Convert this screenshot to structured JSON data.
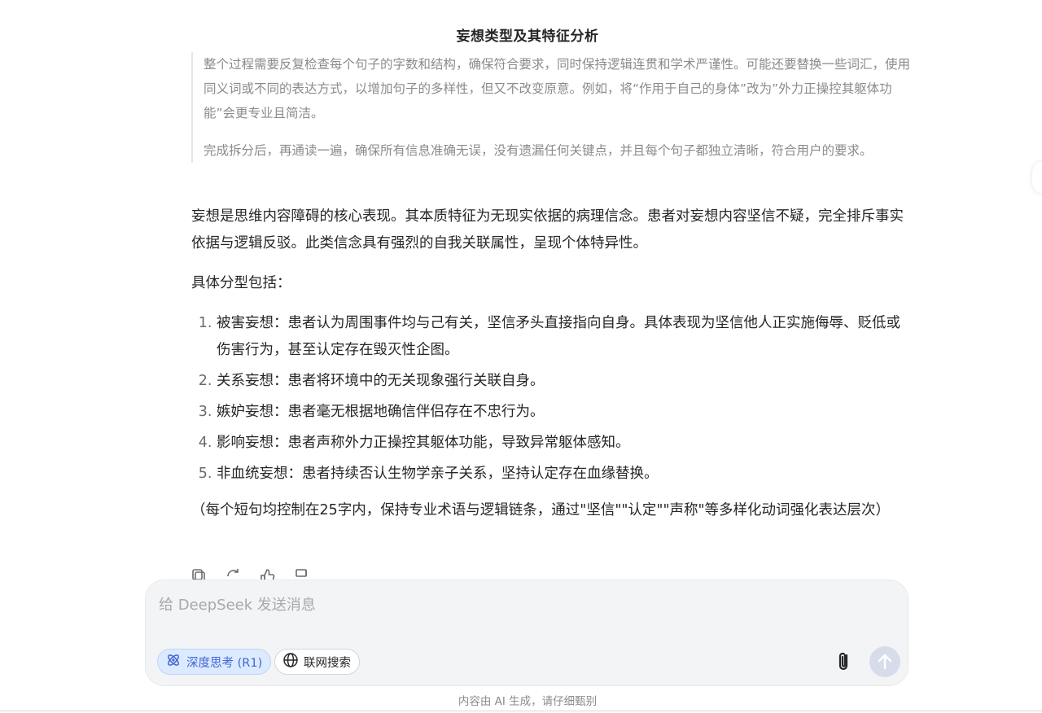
{
  "header": {
    "title": "妄想类型及其特征分析"
  },
  "thinking": {
    "paragraphs": [
      "整个过程需要反复检查每个句子的字数和结构，确保符合要求，同时保持逻辑连贯和学术严谨性。可能还要替换一些词汇，使用同义词或不同的表达方式，以增加句子的多样性，但又不改变原意。例如，将“作用于自己的身体”改为”外力正操控其躯体功能”会更专业且简洁。",
      "完成拆分后，再通读一遍，确保所有信息准确无误，没有遗漏任何关键点，并且每个句子都独立清晰，符合用户的要求。"
    ]
  },
  "answer": {
    "intro": "妄想是思维内容障碍的核心表现。其本质特征为无现实依据的病理信念。患者对妄想内容坚信不疑，完全排斥事实依据与逻辑反驳。此类信念具有强烈的自我关联属性，呈现个体特异性。",
    "list_heading": "具体分型包括：",
    "items": [
      "被害妄想：患者认为周围事件均与己有关，坚信矛头直接指向自身。具体表现为坚信他人正实施侮辱、贬低或伤害行为，甚至认定存在毁灭性企图。",
      "关系妄想：患者将环境中的无关现象强行关联自身。",
      "嫉妒妄想：患者毫无根据地确信伴侣存在不忠行为。",
      "影响妄想：患者声称外力正操控其躯体功能，导致异常躯体感知。",
      "非血统妄想：患者持续否认生物学亲子关系，坚持认定存在血缘替换。"
    ],
    "note": "（每个短句均控制在25字内，保持专业术语与逻辑链条，通过\"坚信\"\"认定\"\"声称\"等多样化动词强化表达层次）"
  },
  "message_actions": {
    "icons": [
      "copy-icon",
      "regenerate-icon",
      "thumbs-up-icon",
      "thumbs-down-icon"
    ]
  },
  "composer": {
    "placeholder": "给 DeepSeek 发送消息",
    "deep_think_label": "深度思考 (R1)",
    "web_search_label": "联网搜索",
    "attach_icon": "paperclip-icon",
    "send_icon": "arrow-up-icon"
  },
  "footer": {
    "disclaimer": "内容由 AI 生成，请仔细甄别"
  },
  "colors": {
    "accent": "#4166d5",
    "chip_active_bg": "#dbeafe",
    "composer_bg": "#f3f4f6",
    "thinking_text": "#8b8b8b",
    "send_disabled": "#d6dcea"
  }
}
